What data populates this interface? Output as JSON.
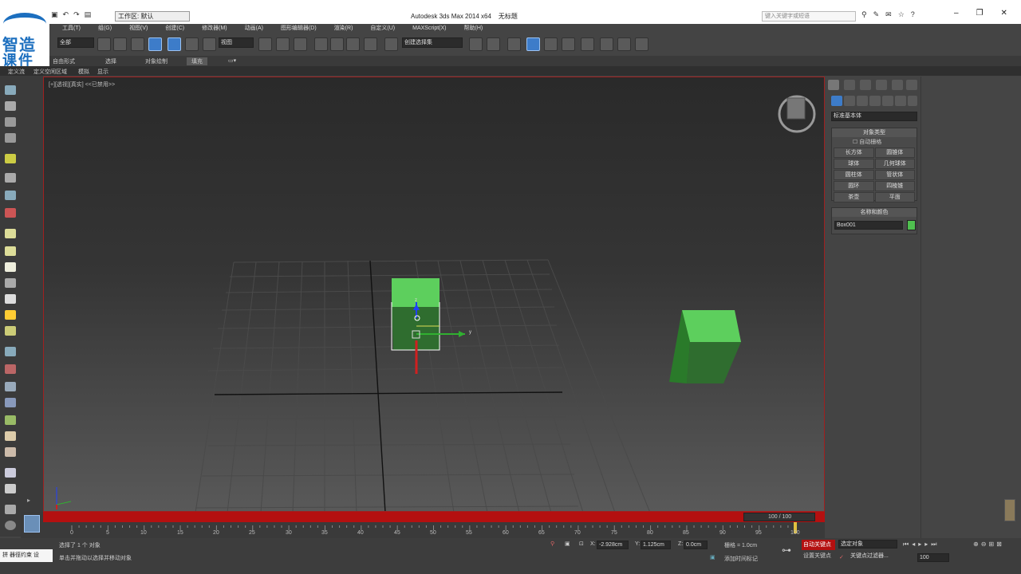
{
  "titlebar": {
    "workspace_label": "工作区: 默认",
    "app_title": "Autodesk 3ds Max  2014 x64",
    "doc_title": "无标题",
    "search_placeholder": "键入关键字或短语"
  },
  "logo": {
    "line1": "智造",
    "line2": "课件"
  },
  "menubar": {
    "items": [
      "工具(T)",
      "组(G)",
      "视图(V)",
      "创建(C)",
      "修改器(M)",
      "动画(A)",
      "图形编辑器(D)",
      "渲染(R)",
      "自定义(U)",
      "MAXScript(X)",
      "帮助(H)"
    ]
  },
  "toolbar": {
    "filter": "全部",
    "ref_coord": "视图",
    "named_selection": "创建选择集"
  },
  "ribbon": {
    "tabs": [
      "自由形式",
      "选择",
      "对象绘制",
      "填充"
    ]
  },
  "subribbon": {
    "items": [
      "定义流",
      "定义空闲区域",
      "模拟",
      "显示"
    ]
  },
  "viewport": {
    "label": "[+][透视][真实]  <<已禁用>>",
    "axis_x": "x",
    "axis_y": "y",
    "axis_z": "z"
  },
  "timeline": {
    "frame_display": "100 / 100",
    "ticks": [
      "0",
      "5",
      "10",
      "15",
      "20",
      "25",
      "30",
      "35",
      "40",
      "45",
      "50",
      "55",
      "60",
      "65",
      "70",
      "75",
      "80",
      "85",
      "90",
      "95",
      "100"
    ]
  },
  "status": {
    "ime": "拼 器徑约束 设",
    "selected": "选择了 1 个 对象",
    "prompt": "单击并拖动以选择并移动对象",
    "x_label": "X:",
    "x_value": "-2.928cm",
    "y_label": "Y:",
    "y_value": "1.125cm",
    "z_label": "Z:",
    "z_value": "0.0cm",
    "grid": "栅格 = 1.0cm",
    "add_time_tag": "添加时间标记",
    "auto_key": "自动关键点",
    "set_key": "设置关键点",
    "selected_object": "选定对象",
    "key_filters": "关键点过滤器...",
    "frame": "100"
  },
  "cmdpanel": {
    "category": "标准基本体",
    "object_type_header": "对象类型",
    "autogrid": "自动栅格",
    "buttons": [
      "长方体",
      "圆锥体",
      "球体",
      "几何球体",
      "圆柱体",
      "管状体",
      "圆环",
      "四棱锥",
      "茶壶",
      "平面"
    ],
    "name_color_header": "名称和颜色",
    "object_name": "Box001",
    "object_color": "#4fbf4f"
  },
  "colors": {
    "accent_blue": "#3d7cc9",
    "timebar_red": "#b41010",
    "box_green": "#4fbf4f"
  }
}
